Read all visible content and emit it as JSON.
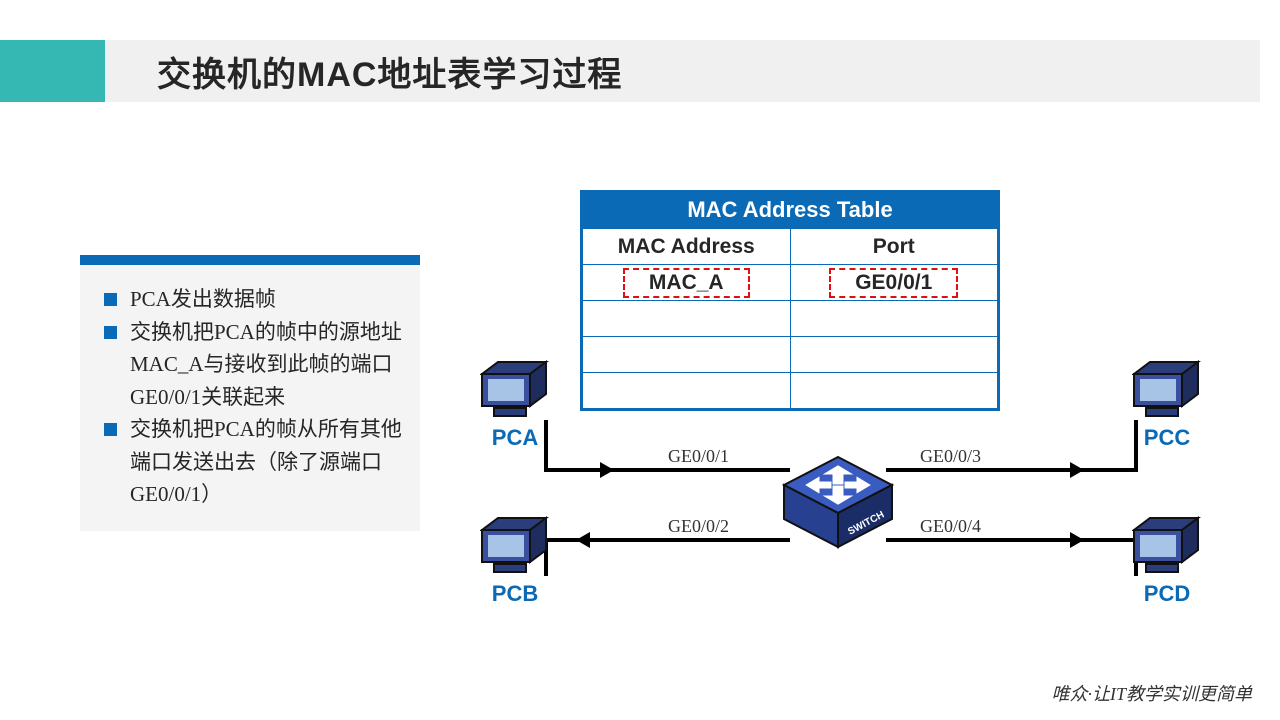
{
  "title": "交换机的MAC地址表学习过程",
  "points": {
    "p1": "PCA发出数据帧",
    "p2": "交换机把PCA的帧中的源地址MAC_A与接收到此帧的端口GE0/0/1关联起来",
    "p3": "交换机把PCA的帧从所有其他端口发送出去（除了源端口GE0/0/1）"
  },
  "mac_table": {
    "title": "MAC Address Table",
    "col1": "MAC Address",
    "col2": "Port",
    "row1_mac": "MAC_A",
    "row1_port": "GE0/0/1"
  },
  "pcs": {
    "a": "PCA",
    "b": "PCB",
    "c": "PCC",
    "d": "PCD"
  },
  "ports": {
    "p1": "GE0/0/1",
    "p2": "GE0/0/2",
    "p3": "GE0/0/3",
    "p4": "GE0/0/4"
  },
  "switch_label": "SWITCH",
  "footer": "唯众·让IT教学实训更简单"
}
